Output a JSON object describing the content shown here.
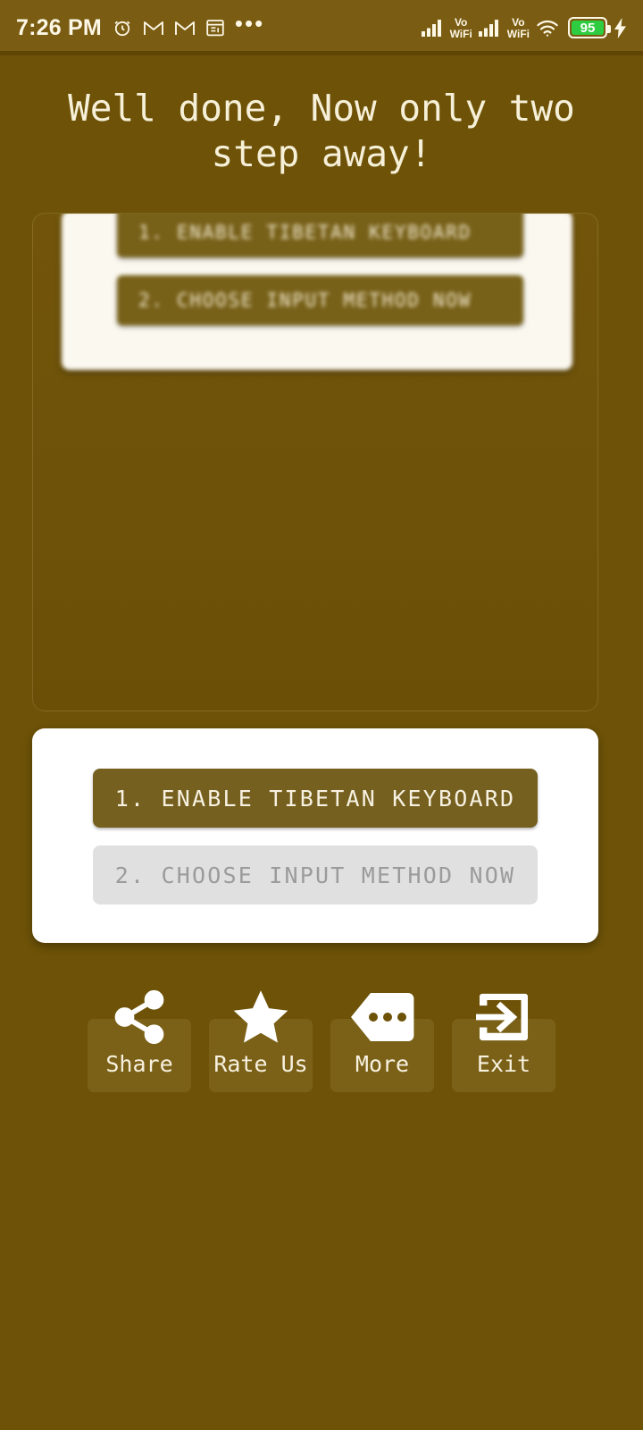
{
  "status_bar": {
    "time": "7:26 PM",
    "left_icons": [
      "alarm-clock-icon",
      "gmail-icon",
      "gmail-icon",
      "calendar-icon",
      "more-notifications-icon"
    ],
    "overflow_dots": "•••",
    "signal_1": "signal-bars-icon",
    "vowifi_1_top": "Vo",
    "vowifi_1_bottom": "WiFi",
    "signal_2": "signal-bars-icon",
    "vowifi_2_top": "Vo",
    "vowifi_2_bottom": "WiFi",
    "wifi": "wifi-icon",
    "battery_percent": "95",
    "charging": "charging-bolt-icon",
    "battery_fill_color": "#2ecc40"
  },
  "headline": {
    "text": "Well done, Now only two step away!"
  },
  "ad_preview": {
    "blurred_step_1": "1. ENABLE TIBETAN KEYBOARD",
    "blurred_step_2": "2. CHOOSE INPUT METHOD NOW"
  },
  "main_card": {
    "step_1_label": "1. ENABLE TIBETAN KEYBOARD",
    "step_2_label": "2. CHOOSE INPUT METHOD NOW",
    "step_1_state": "enabled",
    "step_2_state": "disabled",
    "step_1_color": "#75601f",
    "step_2_color": "#e0e0e0"
  },
  "action_bar": {
    "buttons": [
      {
        "label": "Share",
        "icon": "share-icon"
      },
      {
        "label": "Rate Us",
        "icon": "star-icon"
      },
      {
        "label": "More",
        "icon": "more-tag-icon"
      },
      {
        "label": "Exit",
        "icon": "exit-arrow-icon"
      }
    ]
  },
  "theme": {
    "background": "#6d5207",
    "status_bar_background": "#7a5d13",
    "accent_text": "#f7f0d8"
  }
}
